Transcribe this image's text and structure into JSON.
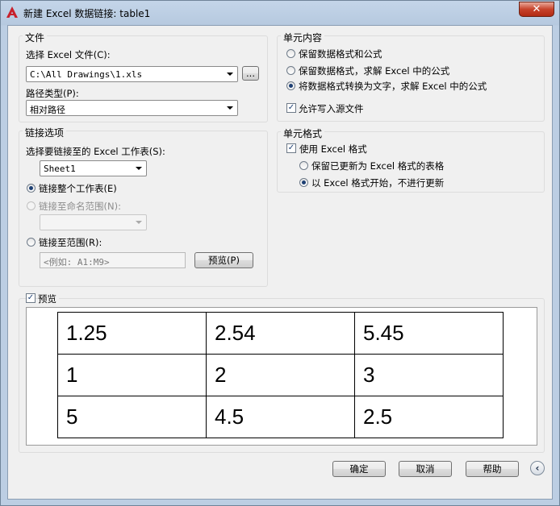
{
  "window": {
    "title": "新建 Excel 数据链接: table1",
    "close_label": "✕"
  },
  "file_group": {
    "title": "文件",
    "select_label": "选择 Excel 文件(C):",
    "file_value": "C:\\All Drawings\\1.xls",
    "browse_label": "...",
    "path_type_label": "路径类型(P):",
    "path_type_value": "相对路径"
  },
  "link_group": {
    "title": "链接选项",
    "sheet_label": "选择要链接至的 Excel 工作表(S):",
    "sheet_value": "Sheet1",
    "option_entire": "链接整个工作表(E)",
    "option_named": "链接至命名范围(N):",
    "named_value": "",
    "option_range": "链接至范围(R):",
    "range_placeholder": "<例如: A1:M9>",
    "preview_button": "预览(P)"
  },
  "cell_content_group": {
    "title": "单元内容",
    "option1": "保留数据格式和公式",
    "option2": "保留数据格式，求解 Excel 中的公式",
    "option3": "将数据格式转换为文字，求解 Excel 中的公式",
    "allow_write": "允许写入源文件"
  },
  "cell_format_group": {
    "title": "单元格式",
    "use_excel": "使用 Excel 格式",
    "keep_updated": "保留已更新为 Excel 格式的表格",
    "start_excel": "以 Excel 格式开始，不进行更新"
  },
  "preview": {
    "label": "预览",
    "rows": [
      [
        "1.25",
        "2.54",
        "5.45"
      ],
      [
        "1",
        "2",
        "3"
      ],
      [
        "5",
        "4.5",
        "2.5"
      ]
    ]
  },
  "footer": {
    "ok": "确定",
    "cancel": "取消",
    "help": "帮助",
    "collapse_icon": "chevron-left-icon"
  }
}
